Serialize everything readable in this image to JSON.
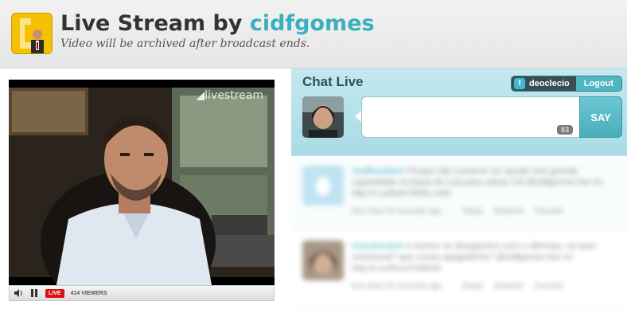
{
  "header": {
    "title_prefix": "Live Stream by ",
    "title_user": "cidfgomes",
    "subtitle": "Video will be archived after broadcast ends."
  },
  "video": {
    "watermark": "livestream",
    "live_label": "LIVE",
    "viewer_count": "414",
    "viewers_label": "VIEWERS"
  },
  "chat": {
    "title": "Chat Live",
    "account_name": "deoclecio",
    "logout_label": "Logout",
    "input_value": "",
    "char_count": "83",
    "say_label": "SAY",
    "messages": [
      {
        "author": "JoelBrasileiro",
        "text": "Porque não construir um açude com grande capacidade na bacia do cuia para salvar Cid @cidfgomes live on http://t.co/6Ub7M0fa.rmf0",
        "time": "less than 20 seconds ago",
        "reply": "Reply",
        "retweet": "Retweet",
        "favorite": "Favorite"
      },
      {
        "author": "lorenamulach",
        "text": "o senhor se desapontou com o dilemias, na lasa-cerimonial? que correu apagadinho? @cidfgomes live on http://t.co/6ucuTu6K0G",
        "time": "less than 20 seconds ago",
        "reply": "Reply",
        "retweet": "Retweet",
        "favorite": "Favorite"
      }
    ]
  }
}
